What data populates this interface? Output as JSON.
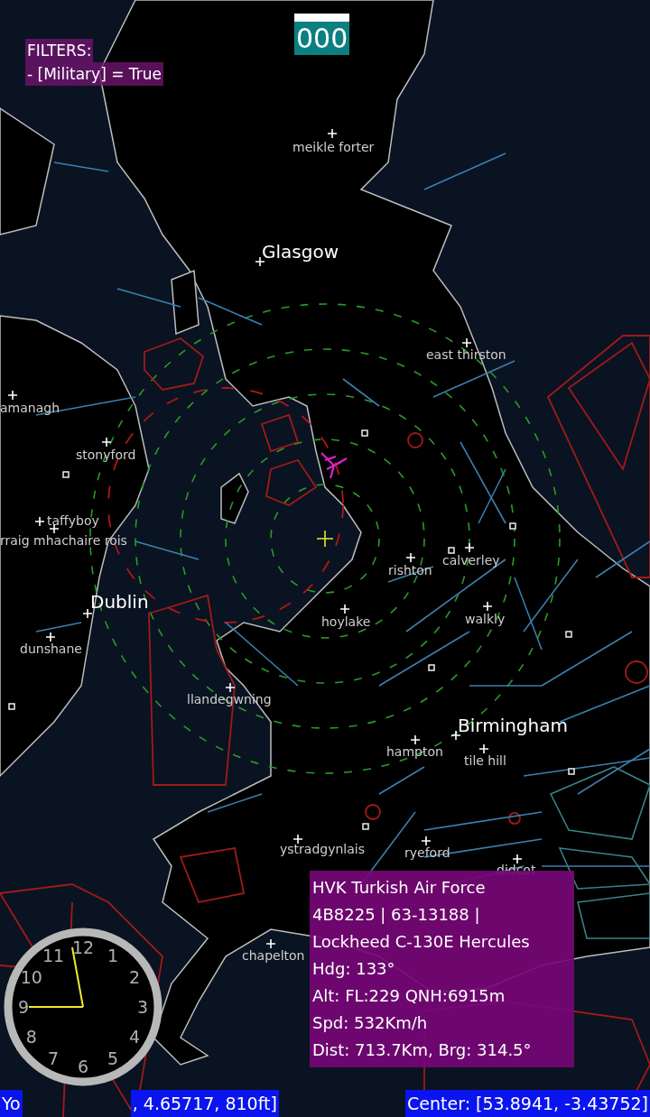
{
  "counter": "000",
  "filters": {
    "title": "FILTERS:",
    "items": [
      "- [Military] = True"
    ]
  },
  "places": [
    {
      "name": "meikle forter",
      "major": false
    },
    {
      "name": "Glasgow",
      "major": true
    },
    {
      "name": "east thirston",
      "major": false
    },
    {
      "name": "amanagh",
      "major": false
    },
    {
      "name": "stonyford",
      "major": false
    },
    {
      "name": "taffyboy",
      "major": false
    },
    {
      "name": "rraig mhachaire rois",
      "major": false
    },
    {
      "name": "Dublin",
      "major": true
    },
    {
      "name": "dunshane",
      "major": false
    },
    {
      "name": "rishton",
      "major": false
    },
    {
      "name": "calverley",
      "major": false
    },
    {
      "name": "hoylake",
      "major": false
    },
    {
      "name": "walkly",
      "major": false
    },
    {
      "name": "llandegwning",
      "major": false
    },
    {
      "name": "Birmingham",
      "major": true
    },
    {
      "name": "hampton",
      "major": false
    },
    {
      "name": "tile hill",
      "major": false
    },
    {
      "name": "ystradgynlais",
      "major": false
    },
    {
      "name": "ryeford",
      "major": false
    },
    {
      "name": "didcot",
      "major": false
    },
    {
      "name": "chapelton",
      "major": false
    }
  ],
  "aircraft_info": {
    "lines": [
      "HVK Turkish Air Force",
      "4B8225 | 63-13188 |",
      "Lockheed C-130E Hercules",
      "Hdg: 133°",
      "Alt: FL:229 QNH:6915m",
      "Spd: 532Km/h",
      "Dist: 713.7Km, Brg: 314.5°"
    ]
  },
  "clock": {
    "numerals": [
      "12",
      "11",
      "1",
      "10",
      "2",
      "9",
      "3",
      "8",
      "4",
      "7",
      "5",
      "6"
    ]
  },
  "status_bar": {
    "position_start": "Yo",
    "position_end": ", 4.65717, 810ft]",
    "center": "Center: [53.8941, -3.43752]"
  }
}
